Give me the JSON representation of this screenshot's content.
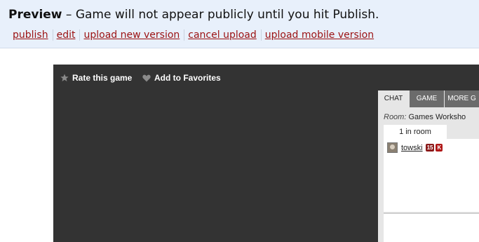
{
  "preview": {
    "title": "Preview",
    "message": " – Game will not appear publicly until you hit Publish.",
    "links": [
      "publish",
      "edit",
      "upload new version",
      "cancel upload",
      "upload mobile version"
    ]
  },
  "game": {
    "rate_label": "Rate this game",
    "favorites_label": "Add to Favorites"
  },
  "chat": {
    "tabs": [
      "CHAT",
      "GAME",
      "MORE G"
    ],
    "active_tab": "CHAT",
    "room_label": "Room:",
    "room_name": "Games Worksho",
    "room_count": "1 in room",
    "users": [
      {
        "name": "towski",
        "level": "15",
        "badge": "K"
      }
    ]
  },
  "colors": {
    "link": "#9b1111",
    "game_bg": "#333333",
    "preview_bg": "#e8f0fb"
  }
}
